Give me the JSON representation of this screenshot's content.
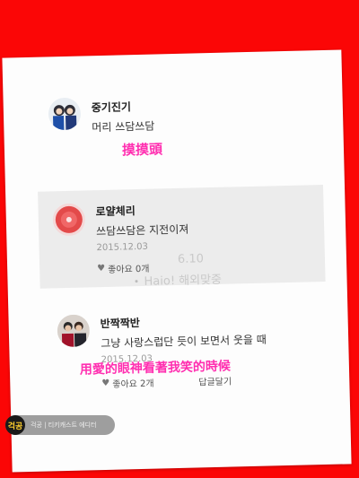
{
  "comments": [
    {
      "name": "중기진기",
      "text": "머리 쓰담쓰담",
      "caption": "摸摸頭"
    },
    {
      "name": "로얄체리",
      "text": "쓰담쓰담은 지전이져",
      "date": "2015.12.03",
      "likes": "좋아요 0개"
    },
    {
      "name": "반짝짝반",
      "text": "그냥 사랑스럽단 듯이 보면서 웃을 때",
      "date": "2015.12.03",
      "likes": "좋아요 2개",
      "reply": "답글달기",
      "caption": "用愛的眼神看著我笑的時候"
    }
  ],
  "ghost": {
    "line1": "6.10",
    "line2": "Haio! 해외맞중"
  },
  "watermark": {
    "logo": "걱공",
    "text": "걱공 | 티키캐스트 에디터"
  },
  "colors": {
    "background": "#fb0606",
    "caption": "#ff2fb0",
    "card": "#fdfdfd"
  }
}
